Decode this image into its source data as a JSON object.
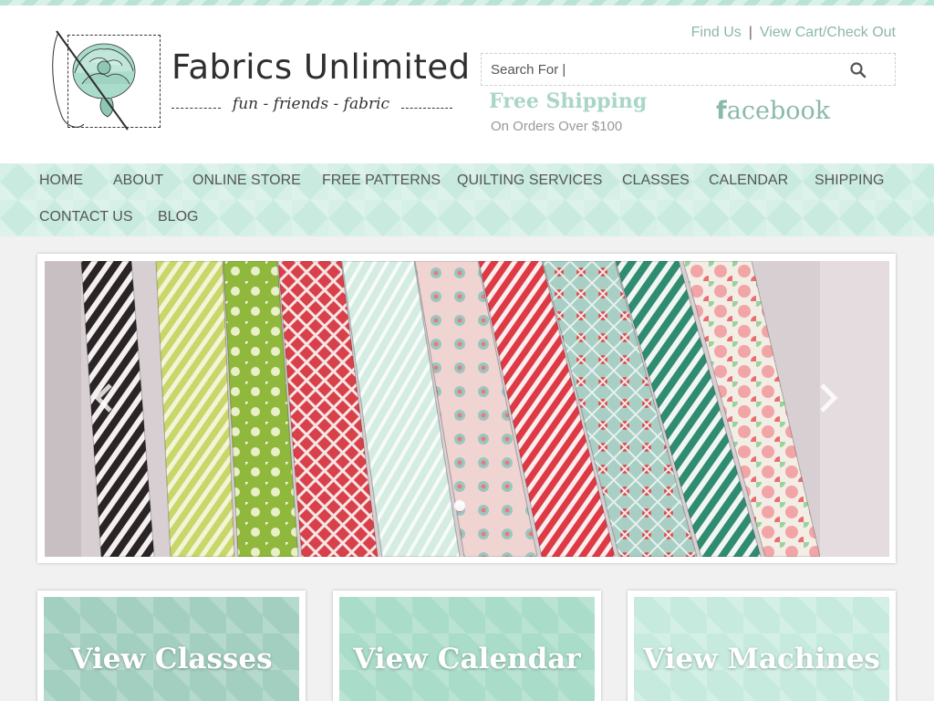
{
  "brand": {
    "name": "Fabrics Unlimited",
    "tagline": "fun - friends - fabric"
  },
  "top_links": {
    "find_us": "Find Us",
    "separator": "|",
    "cart": "View Cart/Check Out"
  },
  "search": {
    "placeholder": "Search For |",
    "button_icon": "search-icon"
  },
  "promo": {
    "title": "Free Shipping",
    "subtitle": "On Orders Over $100"
  },
  "social": {
    "facebook_f": "f",
    "facebook_rest": "acebook"
  },
  "nav": {
    "items": [
      {
        "label": "HOME"
      },
      {
        "label": "ABOUT"
      },
      {
        "label": "ONLINE STORE"
      },
      {
        "label": "FREE PATTERNS"
      },
      {
        "label": "QUILTING SERVICES"
      },
      {
        "label": "CLASSES"
      },
      {
        "label": "CALENDAR"
      },
      {
        "label": "SHIPPING"
      },
      {
        "label": "CONTACT US"
      },
      {
        "label": "BLOG"
      }
    ]
  },
  "slider": {
    "prev_icon": "chevron-left-icon",
    "next_icon": "chevron-right-icon",
    "slide_count": 1,
    "active_slide": 1
  },
  "cards": [
    {
      "label": "View Classes",
      "color": "#a3cfc0"
    },
    {
      "label": "View Calendar",
      "color": "#a9dcc9"
    },
    {
      "label": "View Machines",
      "color": "#c6ebde"
    }
  ],
  "colors": {
    "accent": "#8bb9a8",
    "nav_bg": "#c9ebdf",
    "promo": "#a9d6c5"
  }
}
